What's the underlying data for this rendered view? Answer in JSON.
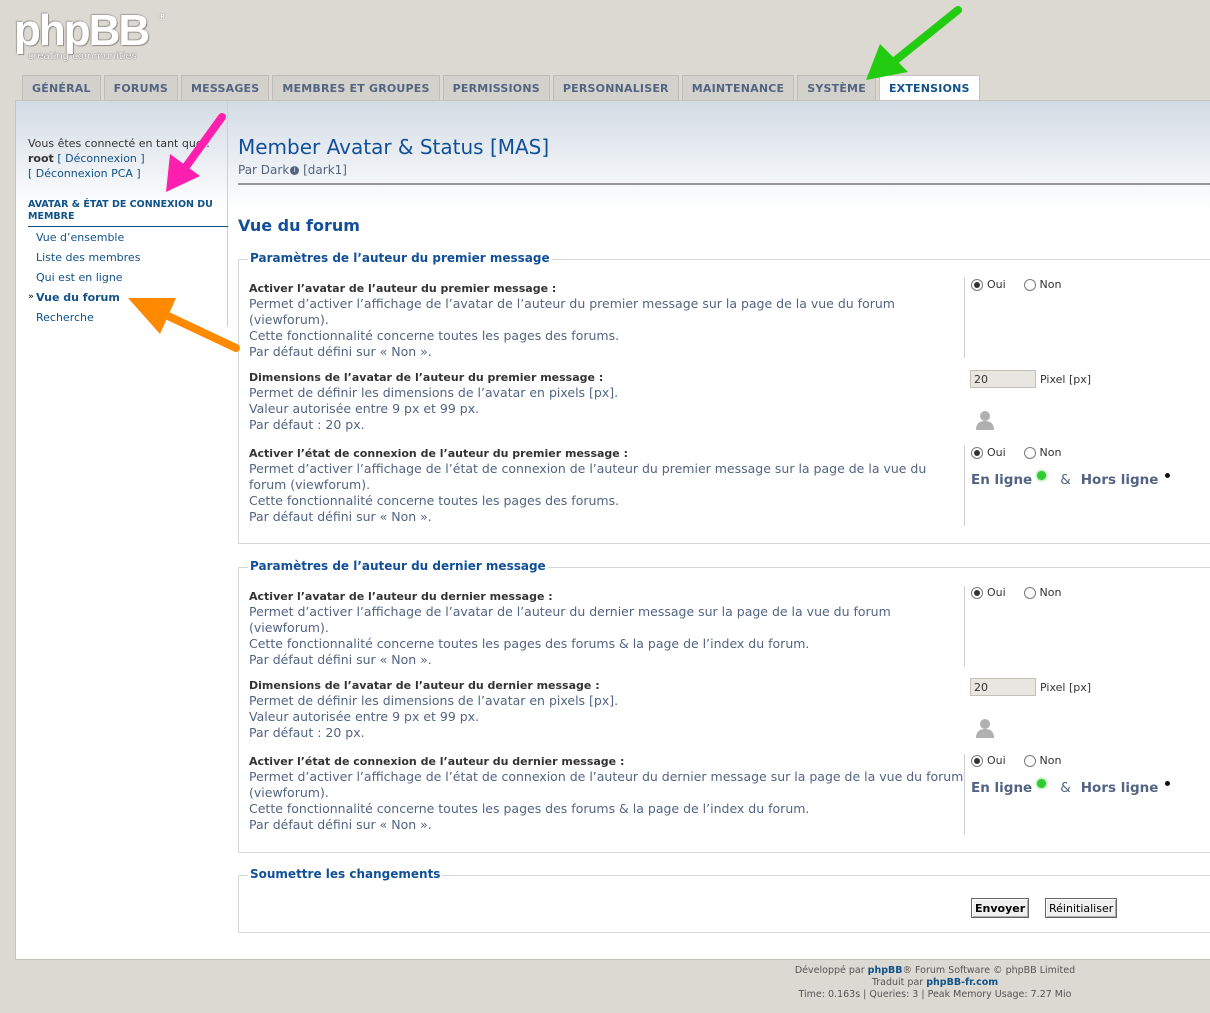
{
  "logo": {
    "word": "phpBB",
    "reg": "®",
    "tagline": "creating   communities"
  },
  "tabs": [
    {
      "label": "GÉNÉRAL",
      "active": false
    },
    {
      "label": "FORUMS",
      "active": false
    },
    {
      "label": "MESSAGES",
      "active": false
    },
    {
      "label": "MEMBRES ET GROUPES",
      "active": false
    },
    {
      "label": "PERMISSIONS",
      "active": false
    },
    {
      "label": "PERSONNALISER",
      "active": false
    },
    {
      "label": "MAINTENANCE",
      "active": false
    },
    {
      "label": "SYSTÈME",
      "active": false
    },
    {
      "label": "EXTENSIONS",
      "active": true
    }
  ],
  "sidebar": {
    "logged_in_text": "Vous êtes connecté en tant que :",
    "username": "root",
    "logout": "[ Déconnexion ]",
    "logout_acp": "[ Déconnexion PCA ]",
    "menu_header": "AVATAR & ÉTAT DE CONNEXION DU MEMBRE",
    "items": [
      {
        "label": "Vue d’ensemble"
      },
      {
        "label": "Liste des membres"
      },
      {
        "label": "Qui est en ligne"
      },
      {
        "label": "Vue du forum"
      },
      {
        "label": "Recherche"
      }
    ]
  },
  "content": {
    "title": "Member Avatar & Status [MAS]",
    "by": "Par Dark",
    "author_handle": "[dark1]",
    "section_title": "Vue du forum"
  },
  "fieldset1": {
    "legend": "Paramètres de l’auteur du premier message",
    "row1": {
      "label": "Activer l’avatar de l’auteur du premier message :",
      "desc": "Permet d’activer l’affichage de l’avatar de l’auteur du premier message sur la page de la vue du forum (viewforum).",
      "desc2": "Cette fonctionnalité concerne toutes les pages des forums.",
      "default": "Par défaut défini sur « Non »."
    },
    "row2": {
      "label": "Dimensions de l’avatar de l’auteur du premier message :",
      "desc": "Permet de définir les dimensions de l’avatar en pixels [px].",
      "desc2": "Valeur autorisée entre 9 px et 99 px.",
      "default": "Par défaut : 20 px.",
      "value": "20",
      "unit": "Pixel [px]"
    },
    "row3": {
      "label": "Activer l’état de connexion de l’auteur du premier message :",
      "desc": "Permet d’activer l’affichage de l’état de connexion de l’auteur du premier message sur la page de la vue du forum (viewforum).",
      "desc2": "Cette fonctionnalité concerne toutes les pages des forums.",
      "default": "Par défaut défini sur « Non »."
    }
  },
  "fieldset2": {
    "legend": "Paramètres de l’auteur du dernier message",
    "row1": {
      "label": "Activer l’avatar de l’auteur du dernier message :",
      "desc": "Permet d’activer l’affichage de l’avatar de l’auteur du dernier message sur la page de la vue du forum (viewforum).",
      "desc2": "Cette fonctionnalité concerne toutes les pages des forums & la page de l’index du forum.",
      "default": "Par défaut défini sur « Non »."
    },
    "row2": {
      "label": "Dimensions de l’avatar de l’auteur du dernier message :",
      "desc": "Permet de définir les dimensions de l’avatar en pixels [px].",
      "desc2": "Valeur autorisée entre 9 px et 99 px.",
      "default": "Par défaut : 20 px.",
      "value": "20",
      "unit": "Pixel [px]"
    },
    "row3": {
      "label": "Activer l’état de connexion de l’auteur du dernier message :",
      "desc": "Permet d’activer l’affichage de l’état de connexion de l’auteur du dernier message sur la page de la vue du forum (viewforum).",
      "desc2": "Cette fonctionnalité concerne toutes les pages des forums & la page de l’index du forum.",
      "default": "Par défaut défini sur « Non »."
    }
  },
  "radio": {
    "yes": "Oui",
    "no": "Non"
  },
  "status": {
    "online": "En ligne",
    "amp": "&",
    "offline": "Hors ligne"
  },
  "submit_section": {
    "legend": "Soumettre les changements",
    "submit": "Envoyer",
    "reset": "Réinitialiser"
  },
  "footer": {
    "line1_pre": "Développé par ",
    "line1_brand": "phpBB",
    "line1_post": "® Forum Software © phpBB Limited",
    "line2_pre": "Traduit par ",
    "line2_brand": "phpBB-fr.com",
    "line3": "Time: 0.163s | Queries: 3 | Peak Memory Usage: 7.27 Mio"
  },
  "colors": {
    "accent": "#105289",
    "title": "#115098",
    "text": "#536482",
    "online": "#2ecc2e"
  },
  "annotations": [
    {
      "name": "green-arrow",
      "color": "#22cc11"
    },
    {
      "name": "magenta-arrow",
      "color": "#ff1fae"
    },
    {
      "name": "orange-arrow",
      "color": "#ff8a00"
    }
  ]
}
